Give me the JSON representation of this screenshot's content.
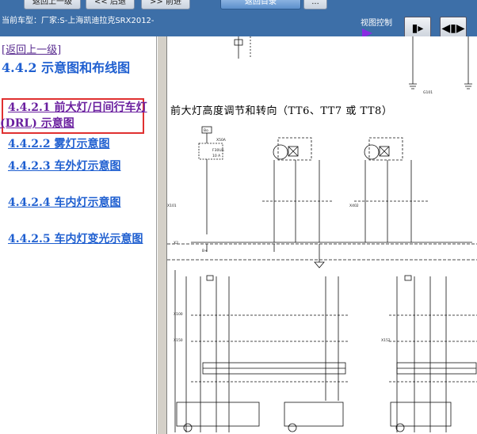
{
  "toolbar": {
    "buttons": [
      "返回上一级",
      "<< 后退",
      ">> 前进",
      "返回目录",
      "..."
    ]
  },
  "info_bar": {
    "car_model": "当前车型：厂家:S-上海凯迪拉克SRX2012-",
    "view_control_label": "视图控制"
  },
  "nav": {
    "back_link": "[返回上一级]",
    "section_title": "4.4.2 示意图和布线图",
    "items": [
      "4.4.2.1 前大灯/日间行车灯 (DRL) 示意图",
      "4.4.2.2 雾灯示意图",
      "4.4.2.3 车外灯示意图",
      "4.4.2.4 车内灯示意图",
      "4.4.2.5 车内灯变光示意图"
    ],
    "selected_index": 0
  },
  "diagram": {
    "title": "前大灯高度调节和转向（TT6、TT7 或 TT8）",
    "labels": [
      "X50A",
      "F30UA",
      "10 A",
      "X101",
      "X402",
      "X100",
      "X150",
      "X152",
      "X2",
      "G101",
      "B+",
      "Bo"
    ]
  }
}
